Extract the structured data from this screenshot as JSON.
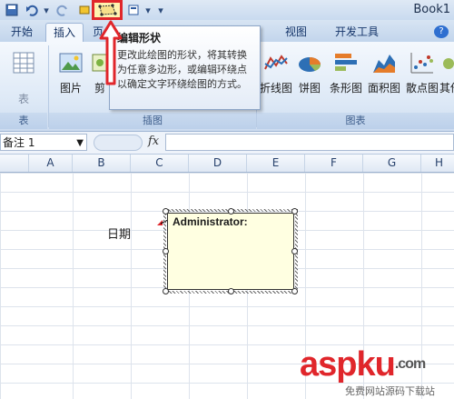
{
  "window": {
    "title": "Book1"
  },
  "tabs": [
    {
      "id": "home",
      "label": "开始"
    },
    {
      "id": "insert",
      "label": "插入",
      "active": true
    },
    {
      "id": "page",
      "label": "页"
    },
    {
      "id": "view",
      "label": "视图"
    },
    {
      "id": "dev",
      "label": "开发工具"
    }
  ],
  "ribbon": {
    "table_label": "表",
    "picture_label": "图片",
    "clip_label": "剪",
    "group_left": "表",
    "group_illustrations": "插图",
    "group_charts": "图表",
    "charts": [
      {
        "id": "line",
        "label": "折线图"
      },
      {
        "id": "pie",
        "label": "饼图"
      },
      {
        "id": "bar",
        "label": "条形图"
      },
      {
        "id": "area",
        "label": "面积图"
      },
      {
        "id": "scatter",
        "label": "散点图"
      },
      {
        "id": "other",
        "label": "其他"
      }
    ]
  },
  "tooltip": {
    "title": "编辑形状",
    "body": "更改此绘图的形状，将其转换为任意多边形，或编辑环绕点以确定文字环绕绘图的方式。"
  },
  "formula_bar": {
    "name_box": "备注 1",
    "fx": "fx",
    "value": ""
  },
  "columns": [
    "A",
    "B",
    "C",
    "D",
    "E",
    "F",
    "G",
    "H"
  ],
  "cells": {
    "c_label": "日期"
  },
  "comment": {
    "author": "Administrator:"
  },
  "watermark": {
    "brand": "aspku",
    "dotcom": ".com",
    "subtitle": "免费网站源码下载站"
  },
  "colors": {
    "accent": "#e0262b",
    "ribbon": "#dce8f6",
    "comment_bg": "#ffffe1"
  }
}
